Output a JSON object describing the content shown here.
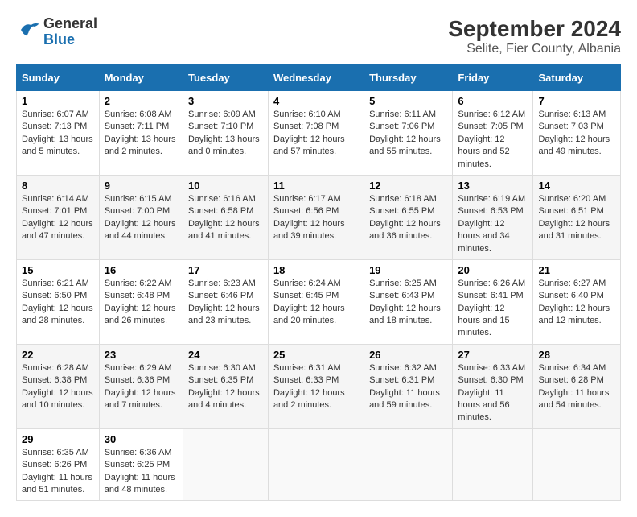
{
  "header": {
    "logo_line1": "General",
    "logo_line2": "Blue",
    "title": "September 2024",
    "subtitle": "Selite, Fier County, Albania"
  },
  "columns": [
    "Sunday",
    "Monday",
    "Tuesday",
    "Wednesday",
    "Thursday",
    "Friday",
    "Saturday"
  ],
  "weeks": [
    [
      {
        "day": "1",
        "info": "Sunrise: 6:07 AM\nSunset: 7:13 PM\nDaylight: 13 hours and 5 minutes."
      },
      {
        "day": "2",
        "info": "Sunrise: 6:08 AM\nSunset: 7:11 PM\nDaylight: 13 hours and 2 minutes."
      },
      {
        "day": "3",
        "info": "Sunrise: 6:09 AM\nSunset: 7:10 PM\nDaylight: 13 hours and 0 minutes."
      },
      {
        "day": "4",
        "info": "Sunrise: 6:10 AM\nSunset: 7:08 PM\nDaylight: 12 hours and 57 minutes."
      },
      {
        "day": "5",
        "info": "Sunrise: 6:11 AM\nSunset: 7:06 PM\nDaylight: 12 hours and 55 minutes."
      },
      {
        "day": "6",
        "info": "Sunrise: 6:12 AM\nSunset: 7:05 PM\nDaylight: 12 hours and 52 minutes."
      },
      {
        "day": "7",
        "info": "Sunrise: 6:13 AM\nSunset: 7:03 PM\nDaylight: 12 hours and 49 minutes."
      }
    ],
    [
      {
        "day": "8",
        "info": "Sunrise: 6:14 AM\nSunset: 7:01 PM\nDaylight: 12 hours and 47 minutes."
      },
      {
        "day": "9",
        "info": "Sunrise: 6:15 AM\nSunset: 7:00 PM\nDaylight: 12 hours and 44 minutes."
      },
      {
        "day": "10",
        "info": "Sunrise: 6:16 AM\nSunset: 6:58 PM\nDaylight: 12 hours and 41 minutes."
      },
      {
        "day": "11",
        "info": "Sunrise: 6:17 AM\nSunset: 6:56 PM\nDaylight: 12 hours and 39 minutes."
      },
      {
        "day": "12",
        "info": "Sunrise: 6:18 AM\nSunset: 6:55 PM\nDaylight: 12 hours and 36 minutes."
      },
      {
        "day": "13",
        "info": "Sunrise: 6:19 AM\nSunset: 6:53 PM\nDaylight: 12 hours and 34 minutes."
      },
      {
        "day": "14",
        "info": "Sunrise: 6:20 AM\nSunset: 6:51 PM\nDaylight: 12 hours and 31 minutes."
      }
    ],
    [
      {
        "day": "15",
        "info": "Sunrise: 6:21 AM\nSunset: 6:50 PM\nDaylight: 12 hours and 28 minutes."
      },
      {
        "day": "16",
        "info": "Sunrise: 6:22 AM\nSunset: 6:48 PM\nDaylight: 12 hours and 26 minutes."
      },
      {
        "day": "17",
        "info": "Sunrise: 6:23 AM\nSunset: 6:46 PM\nDaylight: 12 hours and 23 minutes."
      },
      {
        "day": "18",
        "info": "Sunrise: 6:24 AM\nSunset: 6:45 PM\nDaylight: 12 hours and 20 minutes."
      },
      {
        "day": "19",
        "info": "Sunrise: 6:25 AM\nSunset: 6:43 PM\nDaylight: 12 hours and 18 minutes."
      },
      {
        "day": "20",
        "info": "Sunrise: 6:26 AM\nSunset: 6:41 PM\nDaylight: 12 hours and 15 minutes."
      },
      {
        "day": "21",
        "info": "Sunrise: 6:27 AM\nSunset: 6:40 PM\nDaylight: 12 hours and 12 minutes."
      }
    ],
    [
      {
        "day": "22",
        "info": "Sunrise: 6:28 AM\nSunset: 6:38 PM\nDaylight: 12 hours and 10 minutes."
      },
      {
        "day": "23",
        "info": "Sunrise: 6:29 AM\nSunset: 6:36 PM\nDaylight: 12 hours and 7 minutes."
      },
      {
        "day": "24",
        "info": "Sunrise: 6:30 AM\nSunset: 6:35 PM\nDaylight: 12 hours and 4 minutes."
      },
      {
        "day": "25",
        "info": "Sunrise: 6:31 AM\nSunset: 6:33 PM\nDaylight: 12 hours and 2 minutes."
      },
      {
        "day": "26",
        "info": "Sunrise: 6:32 AM\nSunset: 6:31 PM\nDaylight: 11 hours and 59 minutes."
      },
      {
        "day": "27",
        "info": "Sunrise: 6:33 AM\nSunset: 6:30 PM\nDaylight: 11 hours and 56 minutes."
      },
      {
        "day": "28",
        "info": "Sunrise: 6:34 AM\nSunset: 6:28 PM\nDaylight: 11 hours and 54 minutes."
      }
    ],
    [
      {
        "day": "29",
        "info": "Sunrise: 6:35 AM\nSunset: 6:26 PM\nDaylight: 11 hours and 51 minutes."
      },
      {
        "day": "30",
        "info": "Sunrise: 6:36 AM\nSunset: 6:25 PM\nDaylight: 11 hours and 48 minutes."
      },
      {
        "day": "",
        "info": ""
      },
      {
        "day": "",
        "info": ""
      },
      {
        "day": "",
        "info": ""
      },
      {
        "day": "",
        "info": ""
      },
      {
        "day": "",
        "info": ""
      }
    ]
  ]
}
